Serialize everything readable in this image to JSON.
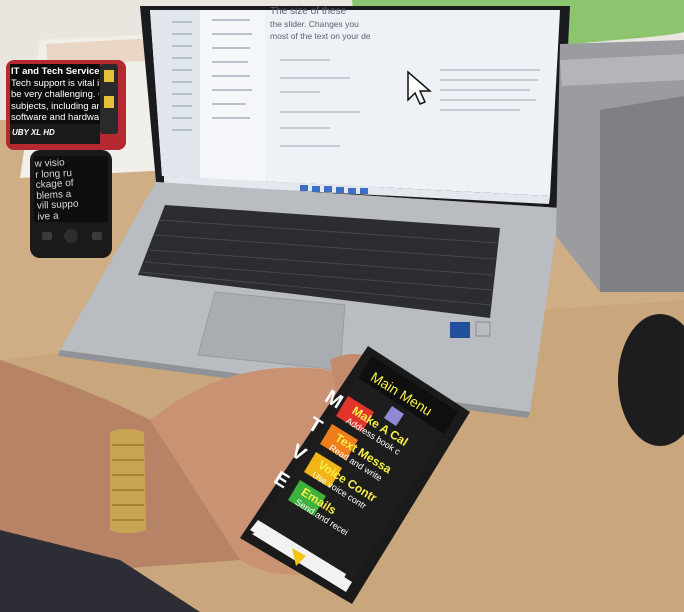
{
  "magnifier": {
    "lines": [
      "IT and Tech Service",
      "Tech support is vital in c",
      "be very challenging. Ou",
      "subjects, including an i",
      "software and hardware"
    ],
    "brand": "UBY XL HD"
  },
  "laptop": {
    "heading_lines": [
      "The size of these",
      "the slider. Changes you",
      "most of the text on your de"
    ]
  },
  "phone_left": {
    "lines": [
      "w visio",
      "r long ru",
      "ckage of",
      "blems a",
      "vill suppo",
      "ive a"
    ]
  },
  "phone_main": {
    "title": "Main Menu",
    "items": [
      {
        "letter": "M",
        "label": "Make A Cal",
        "sub": "Address book c"
      },
      {
        "letter": "T",
        "label": "Text Messa",
        "sub": "Read and write"
      },
      {
        "letter": "V",
        "label": "Voice Contr",
        "sub": "Use voice contr"
      },
      {
        "letter": "E",
        "label": "Emails",
        "sub": "Send and recei"
      }
    ]
  },
  "colors": {
    "desk": "#cfae85",
    "wall": "#e9e6df",
    "laptop_body": "#b9bcc0",
    "keyboard": "#2b2d31",
    "phone_bg": "#1d1d1d",
    "item_m": "#e2342a",
    "item_t": "#f07e1b",
    "item_v": "#f2b517",
    "item_e": "#3cb13c",
    "menu_text": "#f7ef48",
    "sticker": "#8dc56f"
  }
}
